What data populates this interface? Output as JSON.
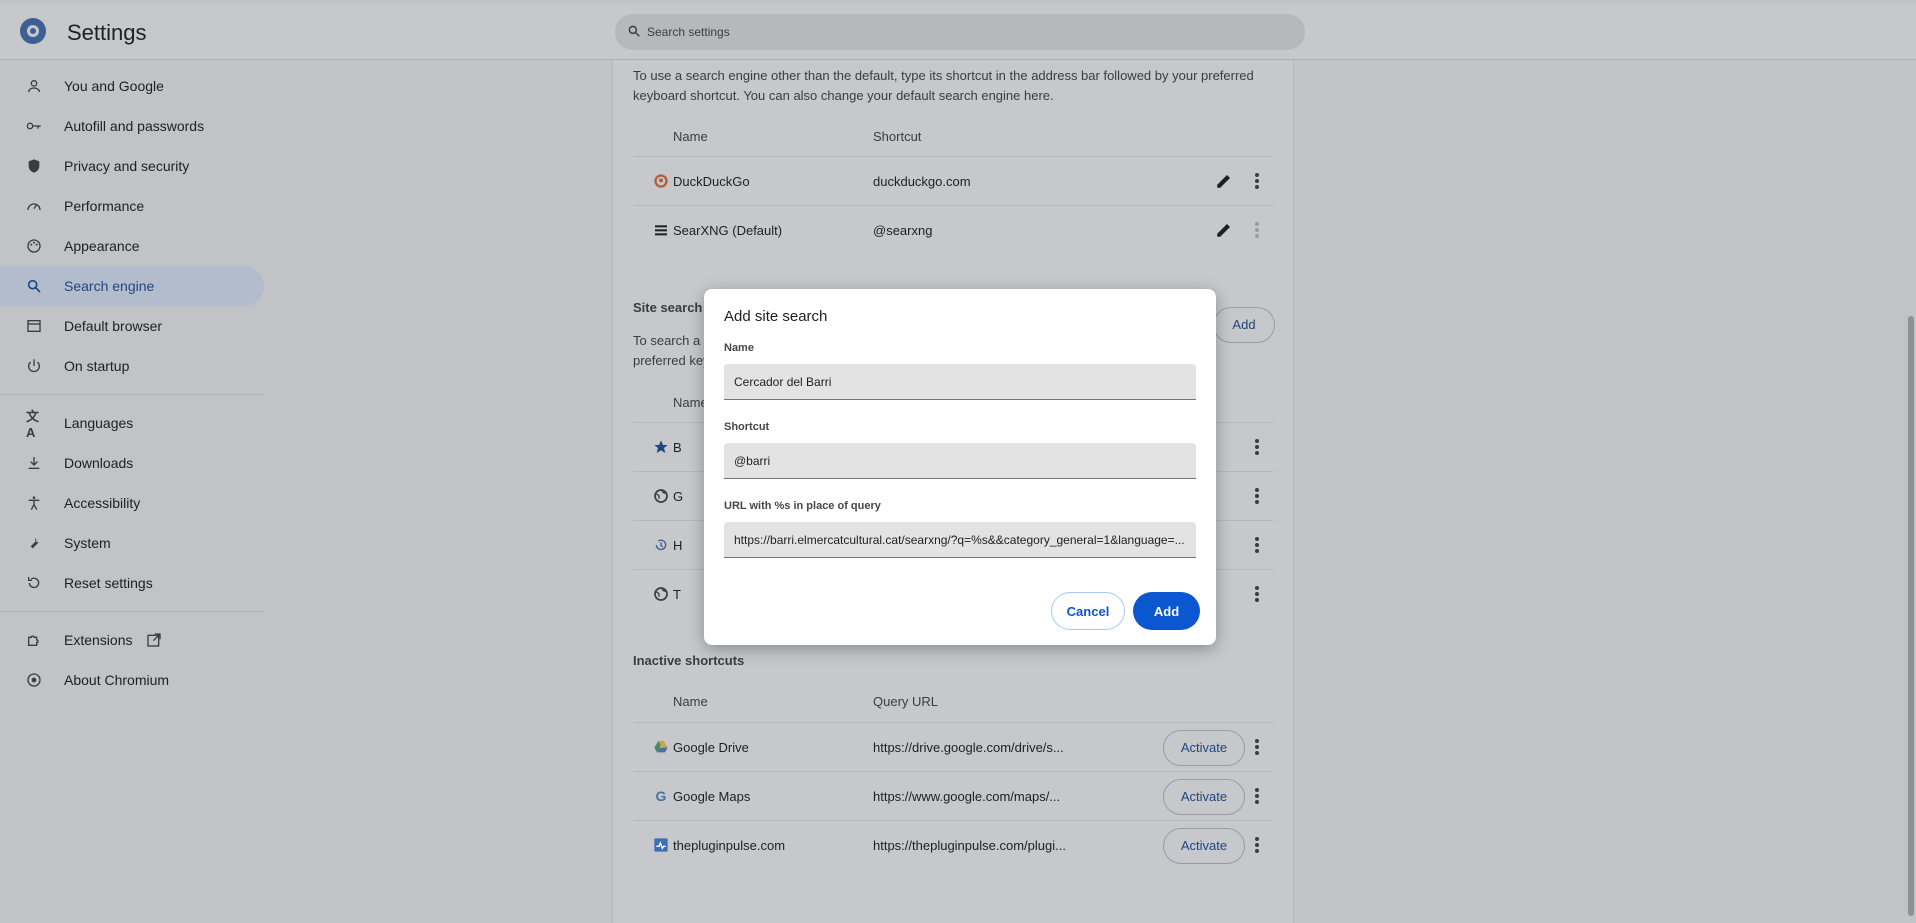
{
  "app": {
    "title": "Settings"
  },
  "search": {
    "placeholder": "Search settings"
  },
  "sidebar": {
    "items": [
      {
        "label": "You and Google",
        "icon": "person-icon"
      },
      {
        "label": "Autofill and passwords",
        "icon": "key-icon"
      },
      {
        "label": "Privacy and security",
        "icon": "shield-icon"
      },
      {
        "label": "Performance",
        "icon": "speedometer-icon"
      },
      {
        "label": "Appearance",
        "icon": "palette-icon"
      },
      {
        "label": "Search engine",
        "icon": "search-icon",
        "active": true
      },
      {
        "label": "Default browser",
        "icon": "browser-icon"
      },
      {
        "label": "On startup",
        "icon": "power-icon"
      },
      {
        "label": "Languages",
        "icon": "translate-icon"
      },
      {
        "label": "Downloads",
        "icon": "download-icon"
      },
      {
        "label": "Accessibility",
        "icon": "accessibility-icon"
      },
      {
        "label": "System",
        "icon": "wrench-icon"
      },
      {
        "label": "Reset settings",
        "icon": "reset-icon"
      },
      {
        "label": "Extensions",
        "icon": "puzzle-icon"
      },
      {
        "label": "About Chromium",
        "icon": "chromium-icon"
      }
    ]
  },
  "main": {
    "intro": "To use a search engine other than the default, type its shortcut in the address bar followed by your preferred keyboard shortcut. You can also change your default search engine here.",
    "search_engines": {
      "col_name": "Name",
      "col_shortcut": "Shortcut",
      "rows": [
        {
          "name": "DuckDuckGo",
          "shortcut": "duckduckgo.com"
        },
        {
          "name": "SearXNG (Default)",
          "shortcut": "@searxng"
        }
      ]
    },
    "site_search": {
      "title": "Site search",
      "intro_line1": "To search a",
      "intro_line2": "preferred key",
      "col_name": "Name",
      "add_label": "Add",
      "rows": [
        {
          "name": "B"
        },
        {
          "name": "G"
        },
        {
          "name": "H"
        },
        {
          "name": "T"
        }
      ]
    },
    "inactive": {
      "title": "Inactive shortcuts",
      "col_name": "Name",
      "col_url": "Query URL",
      "activate_label": "Activate",
      "rows": [
        {
          "name": "Google Drive",
          "url": "https://drive.google.com/drive/s..."
        },
        {
          "name": "Google Maps",
          "url": "https://www.google.com/maps/..."
        },
        {
          "name": "thepluginpulse.com",
          "url": "https://thepluginpulse.com/plugi..."
        }
      ]
    }
  },
  "dialog": {
    "title": "Add site search",
    "name_label": "Name",
    "name_value": "Cercador del Barri",
    "shortcut_label": "Shortcut",
    "shortcut_value": "@barri",
    "url_label": "URL with %s in place of query",
    "url_value": "https://barri.elmercatcultural.cat/searxng/?q=%s&&category_general=1&language=...",
    "cancel_label": "Cancel",
    "add_label": "Add"
  },
  "colors": {
    "accent": "#0b57d0",
    "scrim": "#c1c3c7"
  }
}
